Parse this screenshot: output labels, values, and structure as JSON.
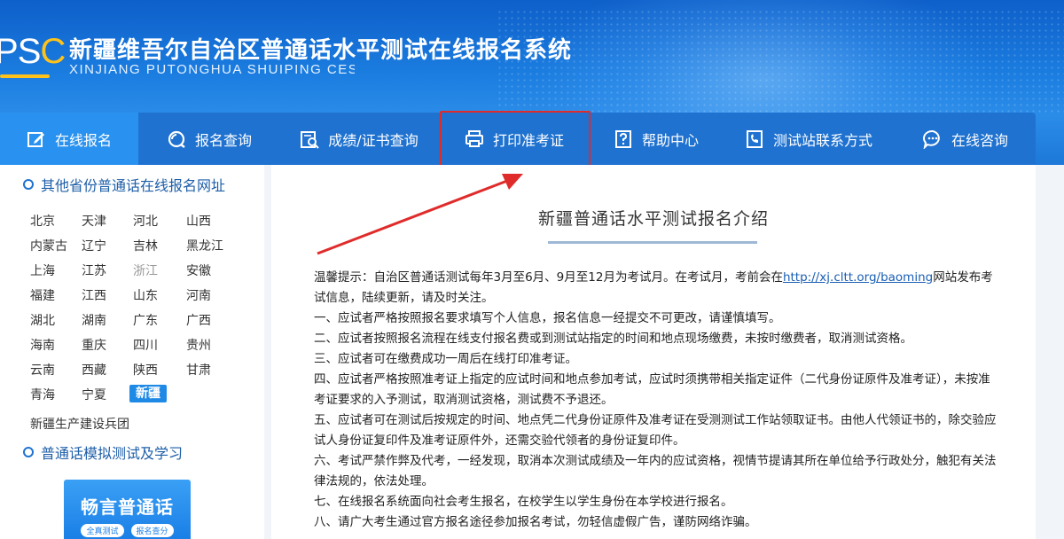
{
  "header": {
    "logo_text_1": "P",
    "logo_text_2": "S",
    "logo_text_3": "C",
    "title": "新疆维吾尔自治区普通话水平测试在线报名系统",
    "subtitle": "XINJIANG PUTONGHUA SHUIPING CESHI"
  },
  "nav": {
    "items": [
      {
        "label": "在线报名",
        "icon": "edit-icon",
        "active": true
      },
      {
        "label": "报名查询",
        "icon": "search-icon"
      },
      {
        "label": "成绩/证书查询",
        "icon": "certificate-search-icon"
      },
      {
        "label": "打印准考证",
        "icon": "printer-icon"
      },
      {
        "label": "帮助中心",
        "icon": "help-icon"
      },
      {
        "label": "测试站联系方式",
        "icon": "phone-book-icon"
      },
      {
        "label": "在线咨询",
        "icon": "chat-icon"
      }
    ]
  },
  "sidebar": {
    "section1_title": "其他省份普通话在线报名网址",
    "provinces": [
      "北京",
      "天津",
      "河北",
      "山西",
      "内蒙古",
      "辽宁",
      "吉林",
      "黑龙江",
      "上海",
      "江苏",
      "浙江",
      "安徽",
      "福建",
      "江西",
      "山东",
      "河南",
      "湖北",
      "湖南",
      "广东",
      "广西",
      "海南",
      "重庆",
      "四川",
      "贵州",
      "云南",
      "西藏",
      "陕西",
      "甘肃",
      "青海",
      "宁夏",
      "新疆"
    ],
    "bingtuan": "新疆生产建设兵团",
    "section2_title": "普通话模拟测试及学习",
    "promo_title": "畅言普通话",
    "promo_tag_1": "全真测试",
    "promo_tag_2": "报名查分"
  },
  "main": {
    "title": "新疆普通话水平测试报名介绍",
    "notice_prefix": "温馨提示：自治区普通话测试每年3月至6月、9月至12月为考试月。在考试月，考前会在",
    "notice_link": "http://xj.cltt.org/baoming",
    "notice_suffix": "网站发布考试信息，陆续更新，请及时关注。",
    "rules": [
      "一、应试者严格按照报名要求填写个人信息，报名信息一经提交不可更改，请谨慎填写。",
      "二、应试者按照报名流程在线支付报名费或到测试站指定的时间和地点现场缴费，未按时缴费者，取消测试资格。",
      "三、应试者可在缴费成功一周后在线打印准考证。",
      "四、应试者严格按照准考证上指定的应试时间和地点参加考试，应试时须携带相关指定证件（二代身份证原件及准考证），未按准考证要求的入予测试，取消测试资格，测试费不予退还。",
      "五、应试者可在测试后按规定的时间、地点凭二代身份证原件及准考证在受测测试工作站领取证书。由他人代领证书的，除交验应试人身份证复印件及准考证原件外，还需交验代领者的身份证复印件。",
      "六、考试严禁作弊及代考，一经发现，取消本次测试成绩及一年内的应试资格，视情节提请其所在单位给予行政处分，触犯有关法律法规的，依法处理。",
      "七、在线报名系统面向社会考生报名，在校学生以学生身份在本学校进行报名。",
      "八、请广大考生通过官方报名途径参加报名考试，勿轻信虚假广告，谨防网络诈骗。"
    ]
  },
  "colors": {
    "header_blue": "#1b7de0",
    "nav_blue": "#1f72d0",
    "nav_active": "#2992f0",
    "highlight_red": "#e02b2b",
    "logo_yellow": "#ffc21a"
  }
}
